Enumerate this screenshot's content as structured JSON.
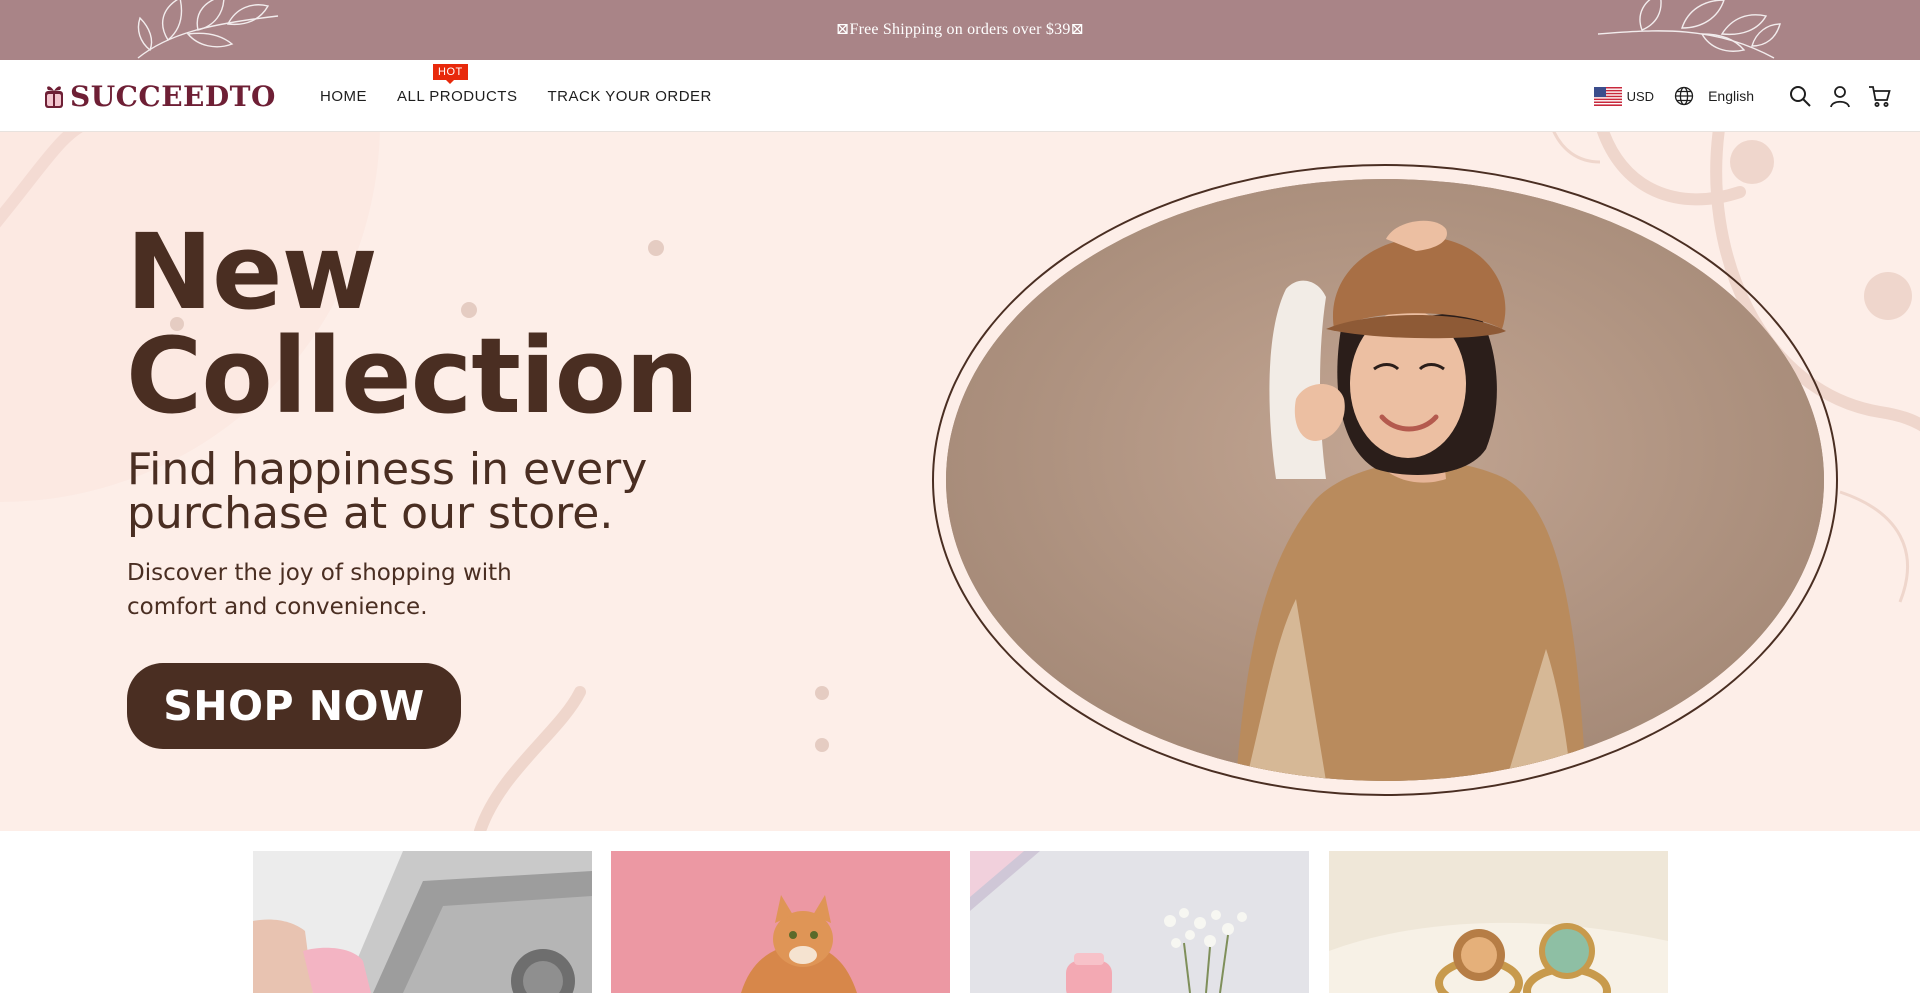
{
  "announcement": {
    "text": "⊠Free Shipping on orders over $39⊠"
  },
  "header": {
    "logo_text": "SUCCEEDTO",
    "nav": [
      {
        "label": "HOME"
      },
      {
        "label": "ALL PRODUCTS",
        "badge": "HOT"
      },
      {
        "label": "TRACK YOUR ORDER"
      }
    ],
    "currency": "USD",
    "language": "English",
    "icons": [
      "search-icon",
      "account-icon",
      "cart-icon"
    ]
  },
  "hero": {
    "title_line1": "New",
    "title_line2": "Collection",
    "subtitle": "Find happiness in every purchase at our store.",
    "description": "Discover the joy of shopping with comfort and convenience.",
    "cta_label": "SHOP NOW"
  },
  "colors": {
    "announcement_bg": "#a98487",
    "hero_bg": "#fdeee8",
    "brand_dark": "#4a2e22",
    "logo": "#6e1f35",
    "badge": "#e8290b"
  }
}
